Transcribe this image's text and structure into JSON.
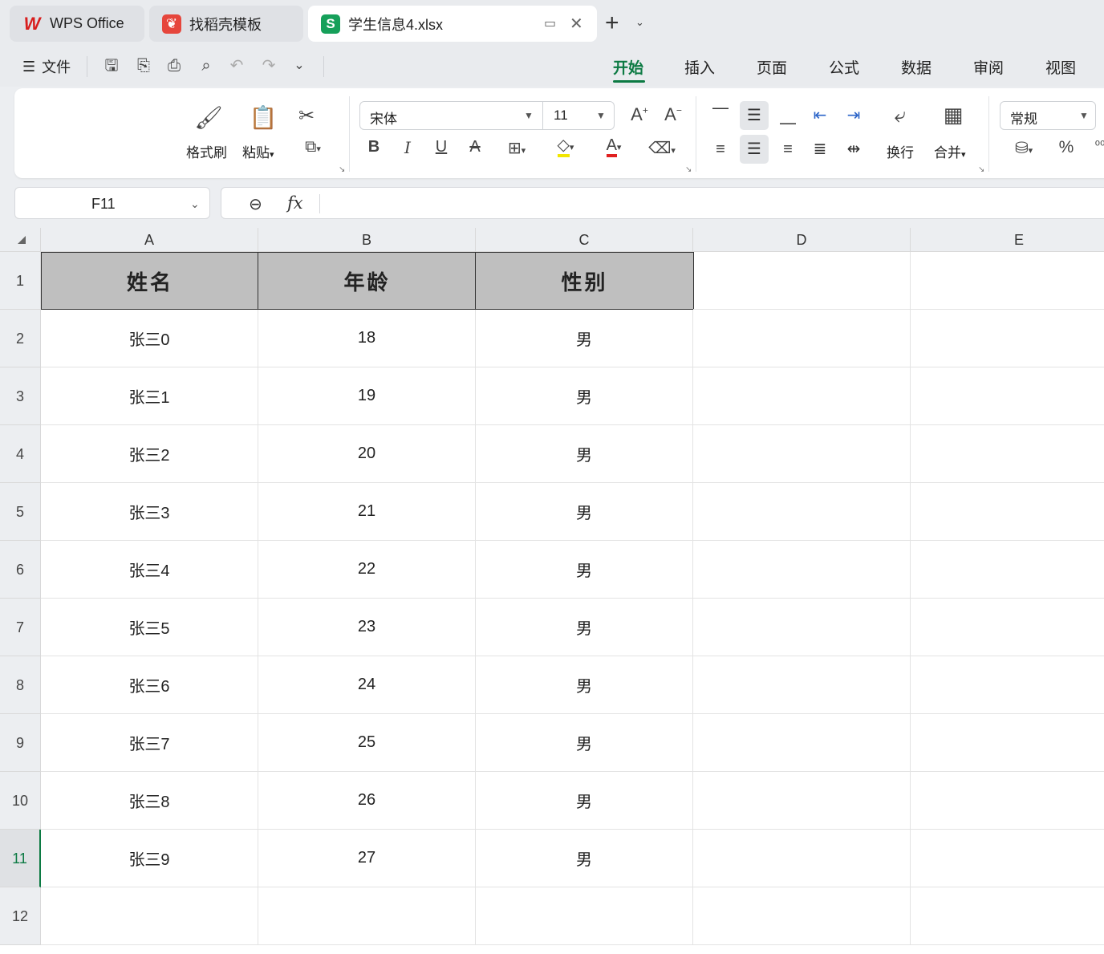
{
  "tabs": [
    {
      "label": "WPS Office",
      "icon": "wps-logo-icon"
    },
    {
      "label": "找稻壳模板",
      "icon": "daoke-icon"
    },
    {
      "label": "学生信息4.xlsx",
      "icon": "spreadsheet-icon",
      "active": true
    }
  ],
  "menu": {
    "file_label": "文件",
    "ribbon_tabs": [
      "开始",
      "插入",
      "页面",
      "公式",
      "数据",
      "审阅",
      "视图"
    ],
    "active_tab": "开始"
  },
  "ribbon": {
    "format_painter": "格式刷",
    "paste": "粘贴",
    "font_name": "宋体",
    "font_size": "11",
    "wrap": "换行",
    "merge": "合并",
    "number_format": "常规"
  },
  "formula_bar": {
    "cell_ref": "F11",
    "fx_label": "fx",
    "formula": ""
  },
  "sheet": {
    "columns": [
      "A",
      "B",
      "C",
      "D",
      "E"
    ],
    "rows": [
      "1",
      "2",
      "3",
      "4",
      "5",
      "6",
      "7",
      "8",
      "9",
      "10",
      "11",
      "12"
    ],
    "selected_row": "11",
    "header": [
      "姓名",
      "年龄",
      "性别"
    ],
    "data": [
      [
        "张三0",
        "18",
        "男"
      ],
      [
        "张三1",
        "19",
        "男"
      ],
      [
        "张三2",
        "20",
        "男"
      ],
      [
        "张三3",
        "21",
        "男"
      ],
      [
        "张三4",
        "22",
        "男"
      ],
      [
        "张三5",
        "23",
        "男"
      ],
      [
        "张三6",
        "24",
        "男"
      ],
      [
        "张三7",
        "25",
        "男"
      ],
      [
        "张三8",
        "26",
        "男"
      ],
      [
        "张三9",
        "27",
        "男"
      ]
    ]
  },
  "colors": {
    "accent": "#0c7a43",
    "header_fill": "#bfbfbf",
    "font_color_bar": "#e02020",
    "highlight_bar": "#f2e600"
  }
}
